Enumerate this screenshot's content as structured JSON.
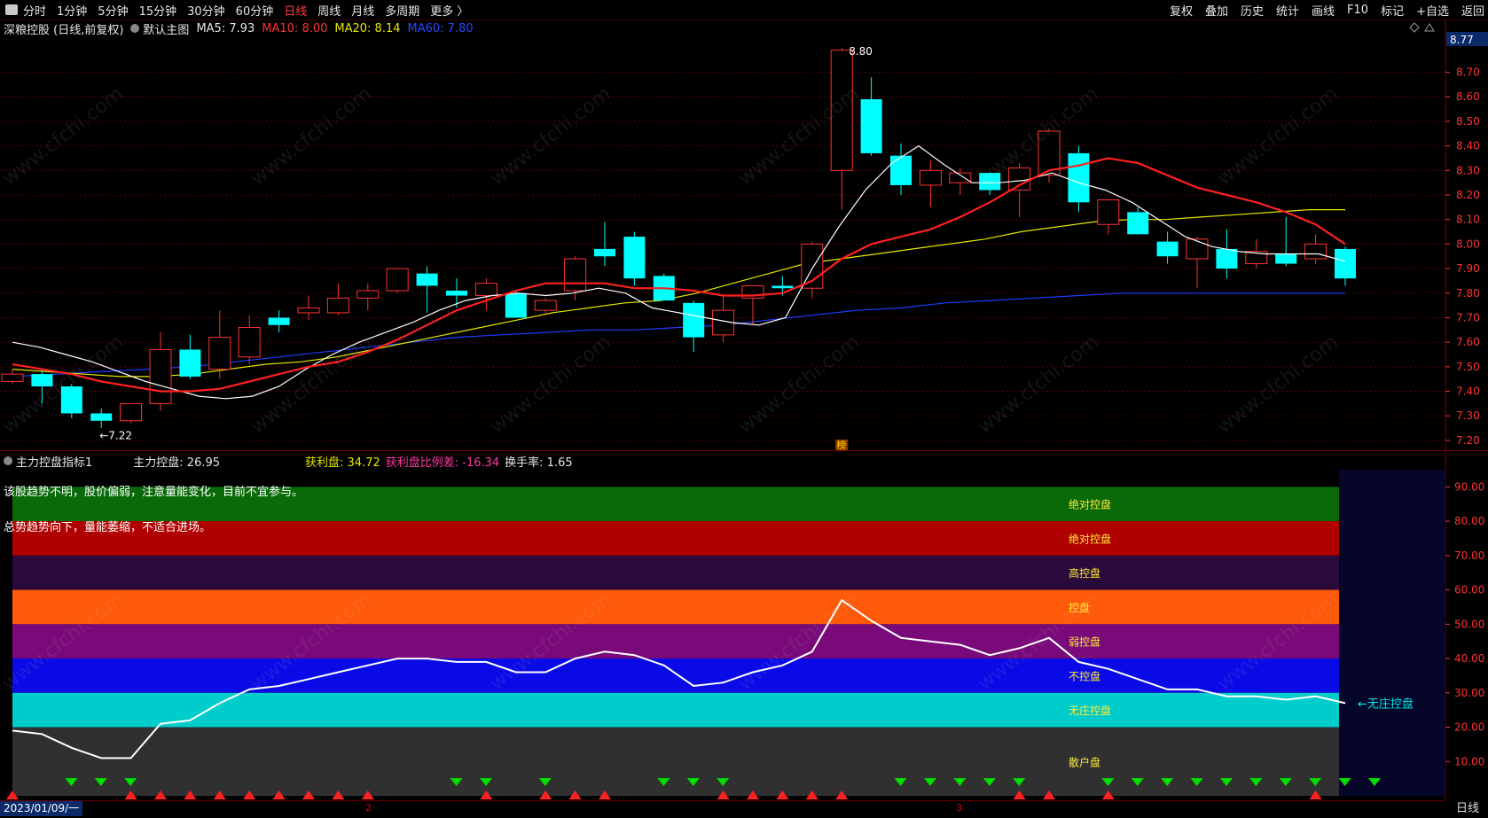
{
  "toolbar": {
    "tabs": [
      {
        "label": "分时",
        "active": false
      },
      {
        "label": "1分钟",
        "active": false
      },
      {
        "label": "5分钟",
        "active": false
      },
      {
        "label": "15分钟",
        "active": false
      },
      {
        "label": "30分钟",
        "active": false
      },
      {
        "label": "60分钟",
        "active": false
      },
      {
        "label": "日线",
        "active": true
      },
      {
        "label": "周线",
        "active": false
      },
      {
        "label": "月线",
        "active": false
      },
      {
        "label": "多周期",
        "active": false
      },
      {
        "label": "更多 〉",
        "active": false
      }
    ],
    "right_buttons": [
      "复权",
      "叠加",
      "历史",
      "统计",
      "画线",
      "F10",
      "标记",
      "+自选",
      "返回"
    ]
  },
  "main_legend": {
    "title": "深粮控股 (日线,前复权)",
    "template": "默认主图",
    "ma5": "MA5: 7.93",
    "ma10": "MA10: 8.00",
    "ma20": "MA20: 8.14",
    "ma60": "MA60: 7.80"
  },
  "sub_legend": {
    "title": "主力控盘指标1",
    "kp": "主力控盘: 26.95",
    "hlp": "获利盘: 34.72",
    "hlpbl": "获利盘比例差: -16.34",
    "hsl": "换手率: 1.65"
  },
  "sub_text": {
    "line1": "该股趋势不明，股价偏弱，注意量能变化，目前不宜参与。",
    "line2": "总势趋势向下，量能萎缩，不适合进场。"
  },
  "watermark": "www.cfchi.com",
  "bottom": {
    "date": "2023/01/09/一",
    "period": "日线",
    "mark2": "2",
    "mark3": "3"
  },
  "colors": {
    "up": "#ff3232",
    "down": "#00ffff",
    "ma5": "#ffffff",
    "ma10": "#ff2020",
    "ma20": "#e6e600",
    "ma60": "#1e3cff",
    "axis": "#ff3232"
  },
  "chart_data": [
    {
      "type": "candlestick",
      "ylim": [
        7.16,
        8.85
      ],
      "yticks": [
        7.2,
        7.3,
        7.4,
        7.5,
        7.6,
        7.7,
        7.8,
        7.9,
        8.0,
        8.1,
        8.2,
        8.3,
        8.4,
        8.5,
        8.6,
        8.7
      ],
      "ytick_labels": [
        "7.20",
        "7.30",
        "7.40",
        "7.50",
        "7.60",
        "7.70",
        "7.80",
        "7.90",
        "8.00",
        "8.10",
        "8.20",
        "8.30",
        "8.40",
        "8.50",
        "8.60",
        "8.70"
      ],
      "last_price_label": "8.77",
      "max_annotation": "8.80",
      "min_annotation": "←7.22",
      "center_badge": "榜",
      "candles": [
        {
          "o": 7.44,
          "h": 7.49,
          "l": 7.43,
          "c": 7.47
        },
        {
          "o": 7.47,
          "h": 7.49,
          "l": 7.35,
          "c": 7.42
        },
        {
          "o": 7.42,
          "h": 7.43,
          "l": 7.29,
          "c": 7.31
        },
        {
          "o": 7.31,
          "h": 7.33,
          "l": 7.25,
          "c": 7.28
        },
        {
          "o": 7.28,
          "h": 7.35,
          "l": 7.27,
          "c": 7.35
        },
        {
          "o": 7.35,
          "h": 7.64,
          "l": 7.32,
          "c": 7.57
        },
        {
          "o": 7.57,
          "h": 7.63,
          "l": 7.45,
          "c": 7.46
        },
        {
          "o": 7.49,
          "h": 7.73,
          "l": 7.45,
          "c": 7.62
        },
        {
          "o": 7.54,
          "h": 7.71,
          "l": 7.51,
          "c": 7.66
        },
        {
          "o": 7.7,
          "h": 7.73,
          "l": 7.64,
          "c": 7.67
        },
        {
          "o": 7.72,
          "h": 7.79,
          "l": 7.69,
          "c": 7.74
        },
        {
          "o": 7.72,
          "h": 7.84,
          "l": 7.71,
          "c": 7.78
        },
        {
          "o": 7.78,
          "h": 7.84,
          "l": 7.73,
          "c": 7.81
        },
        {
          "o": 7.81,
          "h": 7.9,
          "l": 7.8,
          "c": 7.9
        },
        {
          "o": 7.88,
          "h": 7.91,
          "l": 7.72,
          "c": 7.83
        },
        {
          "o": 7.81,
          "h": 7.86,
          "l": 7.74,
          "c": 7.79
        },
        {
          "o": 7.79,
          "h": 7.86,
          "l": 7.73,
          "c": 7.84
        },
        {
          "o": 7.8,
          "h": 7.81,
          "l": 7.7,
          "c": 7.7
        },
        {
          "o": 7.73,
          "h": 7.78,
          "l": 7.71,
          "c": 7.77
        },
        {
          "o": 7.81,
          "h": 7.95,
          "l": 7.77,
          "c": 7.94
        },
        {
          "o": 7.98,
          "h": 8.09,
          "l": 7.91,
          "c": 7.95
        },
        {
          "o": 8.03,
          "h": 8.05,
          "l": 7.83,
          "c": 7.86
        },
        {
          "o": 7.87,
          "h": 7.88,
          "l": 7.77,
          "c": 7.77
        },
        {
          "o": 7.76,
          "h": 7.77,
          "l": 7.56,
          "c": 7.62
        },
        {
          "o": 7.63,
          "h": 7.79,
          "l": 7.6,
          "c": 7.73
        },
        {
          "o": 7.78,
          "h": 7.83,
          "l": 7.67,
          "c": 7.83
        },
        {
          "o": 7.83,
          "h": 7.87,
          "l": 7.79,
          "c": 7.82
        },
        {
          "o": 7.82,
          "h": 8.01,
          "l": 7.78,
          "c": 8.0
        },
        {
          "o": 8.3,
          "h": 8.8,
          "l": 8.14,
          "c": 8.79
        },
        {
          "o": 8.59,
          "h": 8.68,
          "l": 8.36,
          "c": 8.37
        },
        {
          "o": 8.36,
          "h": 8.41,
          "l": 8.2,
          "c": 8.24
        },
        {
          "o": 8.24,
          "h": 8.34,
          "l": 8.15,
          "c": 8.3
        },
        {
          "o": 8.25,
          "h": 8.31,
          "l": 8.2,
          "c": 8.29
        },
        {
          "o": 8.29,
          "h": 8.29,
          "l": 8.2,
          "c": 8.22
        },
        {
          "o": 8.22,
          "h": 8.33,
          "l": 8.11,
          "c": 8.31
        },
        {
          "o": 8.28,
          "h": 8.47,
          "l": 8.25,
          "c": 8.46
        },
        {
          "o": 8.37,
          "h": 8.4,
          "l": 8.13,
          "c": 8.17
        },
        {
          "o": 8.08,
          "h": 8.18,
          "l": 8.04,
          "c": 8.18
        },
        {
          "o": 8.13,
          "h": 8.15,
          "l": 8.04,
          "c": 8.04
        },
        {
          "o": 8.01,
          "h": 8.05,
          "l": 7.92,
          "c": 7.95
        },
        {
          "o": 7.94,
          "h": 8.03,
          "l": 7.82,
          "c": 8.02
        },
        {
          "o": 7.98,
          "h": 8.06,
          "l": 7.86,
          "c": 7.9
        },
        {
          "o": 7.92,
          "h": 8.02,
          "l": 7.9,
          "c": 7.97
        },
        {
          "o": 7.96,
          "h": 8.11,
          "l": 7.91,
          "c": 7.92
        },
        {
          "o": 7.94,
          "h": 8.04,
          "l": 7.92,
          "c": 8.0
        },
        {
          "o": 7.98,
          "h": 7.99,
          "l": 7.83,
          "c": 7.86
        }
      ],
      "ma5": [
        7.6,
        7.58,
        7.55,
        7.52,
        7.48,
        7.44,
        7.41,
        7.38,
        7.37,
        7.38,
        7.42,
        7.49,
        7.55,
        7.6,
        7.64,
        7.68,
        7.73,
        7.77,
        7.79,
        7.8,
        7.79,
        7.8,
        7.82,
        7.8,
        7.74,
        7.72,
        7.7,
        7.68,
        7.67,
        7.7,
        7.9,
        8.07,
        8.22,
        8.33,
        8.4,
        8.32,
        8.25,
        8.25,
        8.26,
        8.29,
        8.25,
        8.22,
        8.17,
        8.1,
        8.03,
        7.99,
        7.97,
        7.96,
        7.96,
        7.96,
        7.93
      ],
      "ma10": [
        7.51,
        7.49,
        7.47,
        7.44,
        7.42,
        7.4,
        7.4,
        7.41,
        7.44,
        7.47,
        7.5,
        7.52,
        7.56,
        7.61,
        7.67,
        7.73,
        7.77,
        7.81,
        7.84,
        7.84,
        7.84,
        7.82,
        7.82,
        7.81,
        7.79,
        7.79,
        7.8,
        7.85,
        7.94,
        8.0,
        8.03,
        8.06,
        8.11,
        8.17,
        8.24,
        8.3,
        8.32,
        8.35,
        8.33,
        8.28,
        8.23,
        8.2,
        8.17,
        8.13,
        8.08,
        8.0
      ],
      "ma20": [
        7.49,
        7.48,
        7.47,
        7.46,
        7.46,
        7.47,
        7.49,
        7.51,
        7.52,
        7.54,
        7.57,
        7.6,
        7.63,
        7.66,
        7.69,
        7.72,
        7.74,
        7.76,
        7.77,
        7.8,
        7.84,
        7.88,
        7.92,
        7.94,
        7.96,
        7.98,
        8.0,
        8.02,
        8.05,
        8.07,
        8.09,
        8.1,
        8.1,
        8.11,
        8.12,
        8.13,
        8.14,
        8.14
      ],
      "ma60": [
        7.46,
        7.47,
        7.48,
        7.49,
        7.5,
        7.52,
        7.54,
        7.56,
        7.58,
        7.6,
        7.62,
        7.63,
        7.64,
        7.65,
        7.65,
        7.66,
        7.67,
        7.69,
        7.71,
        7.73,
        7.74,
        7.76,
        7.77,
        7.78,
        7.79,
        7.8,
        7.8,
        7.8,
        7.8,
        7.8,
        7.8
      ]
    },
    {
      "type": "line",
      "ylim": [
        0,
        95
      ],
      "yticks": [
        10,
        20,
        30,
        40,
        50,
        60,
        70,
        80,
        90
      ],
      "ytick_labels": [
        "10.00",
        "20.00",
        "30.00",
        "40.00",
        "50.00",
        "60.00",
        "70.00",
        "80.00",
        "90.00"
      ],
      "bands": [
        {
          "from": 80,
          "to": 90,
          "label": "绝对控盘",
          "color": "#0a6a0a",
          "label_color": "#ffeb3b"
        },
        {
          "from": 70,
          "to": 80,
          "label": "绝对控盘",
          "color": "#b00000",
          "label_color": "#ffeb3b"
        },
        {
          "from": 60,
          "to": 70,
          "label": "高控盘",
          "color": "#2a0a3a",
          "label_color": "#ffeb3b"
        },
        {
          "from": 50,
          "to": 60,
          "label": "控盘",
          "color": "#ff5a0a",
          "label_color": "#ffeb3b"
        },
        {
          "from": 40,
          "to": 50,
          "label": "弱控盘",
          "color": "#7a0a7a",
          "label_color": "#ffeb3b"
        },
        {
          "from": 30,
          "to": 40,
          "label": "不控盘",
          "color": "#0a0ae6",
          "label_color": "#ffeb3b"
        },
        {
          "from": 20,
          "to": 30,
          "label": "无庄控盘",
          "color": "#00cccc",
          "label_color": "#ffeb3b"
        },
        {
          "from": 0,
          "to": 20,
          "label": "散户盘",
          "color": "#303030",
          "label_color": "#ffeb3b"
        }
      ],
      "end_annotation": "←无庄控盘",
      "series": [
        {
          "name": "主力控盘",
          "values": [
            19,
            18,
            14,
            11,
            11,
            21,
            22,
            27,
            31,
            32,
            34,
            36,
            38,
            40,
            40,
            39,
            39,
            36,
            36,
            40,
            42,
            41,
            38,
            32,
            33,
            36,
            38,
            42,
            57,
            51,
            46,
            45,
            44,
            41,
            43,
            46,
            39,
            37,
            34,
            31,
            31,
            29,
            29,
            28,
            29,
            27
          ]
        }
      ],
      "arrows_down": [
        1,
        2,
        3,
        14,
        15,
        17,
        21,
        22,
        23,
        29,
        30,
        31,
        32,
        33,
        36,
        37,
        38,
        39,
        40,
        41,
        42,
        43,
        44,
        45
      ],
      "arrows_up": [
        0,
        4,
        5,
        6,
        7,
        8,
        9,
        10,
        11,
        12,
        16,
        18,
        19,
        20,
        24,
        25,
        26,
        27,
        28,
        34,
        35,
        37,
        44
      ]
    }
  ]
}
